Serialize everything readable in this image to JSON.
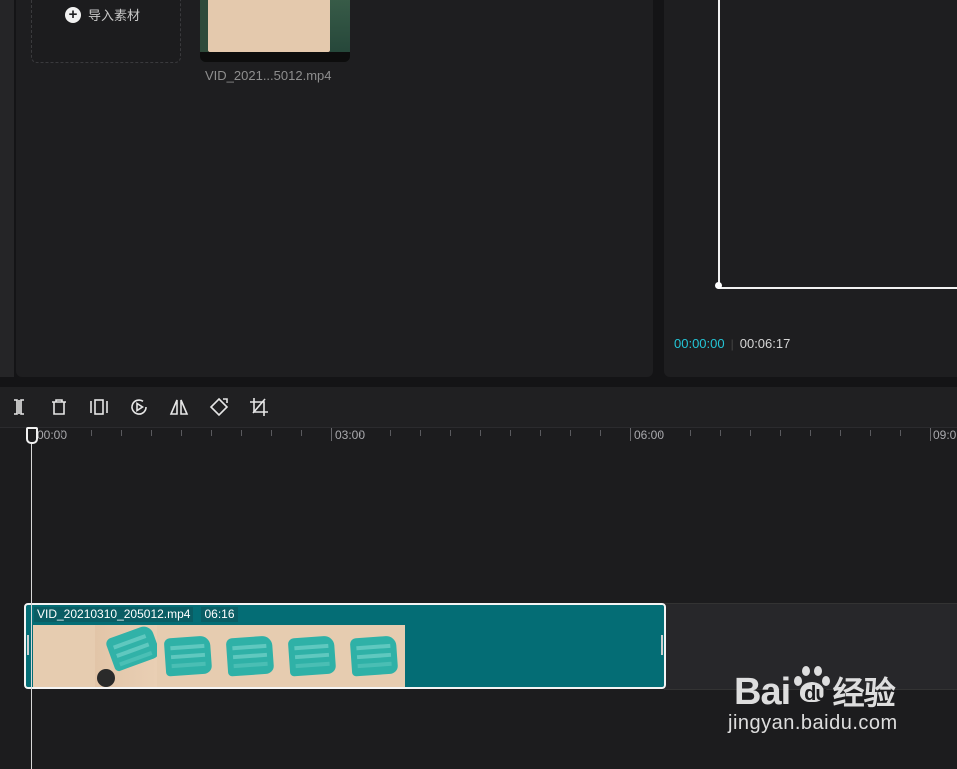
{
  "media": {
    "import_label": "导入素材",
    "clip_name": "VID_2021...5012.mp4"
  },
  "preview": {
    "current_time": "00:00:00",
    "total_time": "00:06:17"
  },
  "toolbar": {
    "tools": [
      "split-icon",
      "delete-icon",
      "freeze-frame-icon",
      "reverse-play-icon",
      "mirror-icon",
      "rotate-icon",
      "crop-icon"
    ]
  },
  "timeline": {
    "ruler_labels": [
      "00:00",
      "03:00",
      "06:00",
      "09:0"
    ],
    "clip": {
      "name": "VID_20210310_205012.mp4",
      "duration": "06:16"
    }
  },
  "watermark": {
    "brand": "Bai",
    "brand_suffix": "du",
    "brand_cn": "经验",
    "url": "jingyan.baidu.com"
  },
  "colors": {
    "accent_time": "#24c5d6",
    "clip_fill": "#046d75",
    "background": "#1c1c1e"
  }
}
